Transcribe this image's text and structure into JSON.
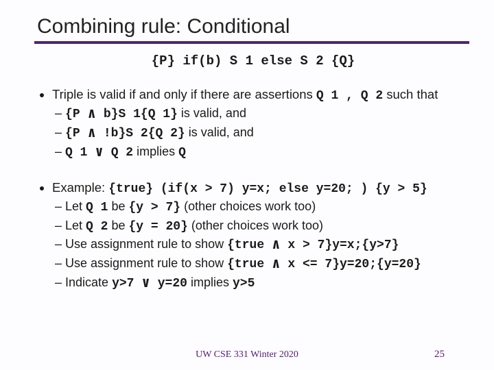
{
  "title": "Combining rule: Conditional",
  "triple": "{P} if(b) S 1 else S 2 {Q}",
  "bullet1_intro_a": "Triple is valid if and only if there are assertions ",
  "bullet1_intro_b": " such that",
  "q1q2": "Q 1 , Q 2",
  "sub1a_1": "{P ",
  "sub1a_2": " b}S 1{Q 1}",
  "sub1a_3": " is valid, and",
  "sub1b_1": "{P ",
  "sub1b_2": " !b}S 2{Q 2}",
  "sub1b_3": " is valid, and",
  "sub1c_1": "Q 1 ",
  "sub1c_2": " Q 2",
  "sub1c_3": " implies ",
  "sub1c_4": "Q",
  "bullet2_intro_a": "Example: ",
  "bullet2_intro_b": "{true} (if(x > 7) y=x; else y=20; ) {y > 5}",
  "sub2a_1": "Let ",
  "sub2a_2": "Q 1",
  "sub2a_3": " be ",
  "sub2a_4": "{y > 7}",
  "sub2a_5": " (other choices work too)",
  "sub2b_1": "Let ",
  "sub2b_2": "Q 2",
  "sub2b_3": " be ",
  "sub2b_4": "{y = 20}",
  "sub2b_5": " (other choices work too)",
  "sub2c_1": "Use assignment rule to show ",
  "sub2c_2": "{true ",
  "sub2c_3": " x > 7}y=x;{y>7}",
  "sub2d_1": "Use assignment rule to show ",
  "sub2d_2": "{true ",
  "sub2d_3": " x <= 7}y=20;{y=20}",
  "sub2e_1": "Indicate ",
  "sub2e_2": "y>7 ",
  "sub2e_3": " y=20",
  "sub2e_4": " implies ",
  "sub2e_5": "y>5",
  "and_sym": "∧",
  "or_sym": "∨",
  "footer": "UW CSE 331 Winter 2020",
  "pagenum": "25"
}
